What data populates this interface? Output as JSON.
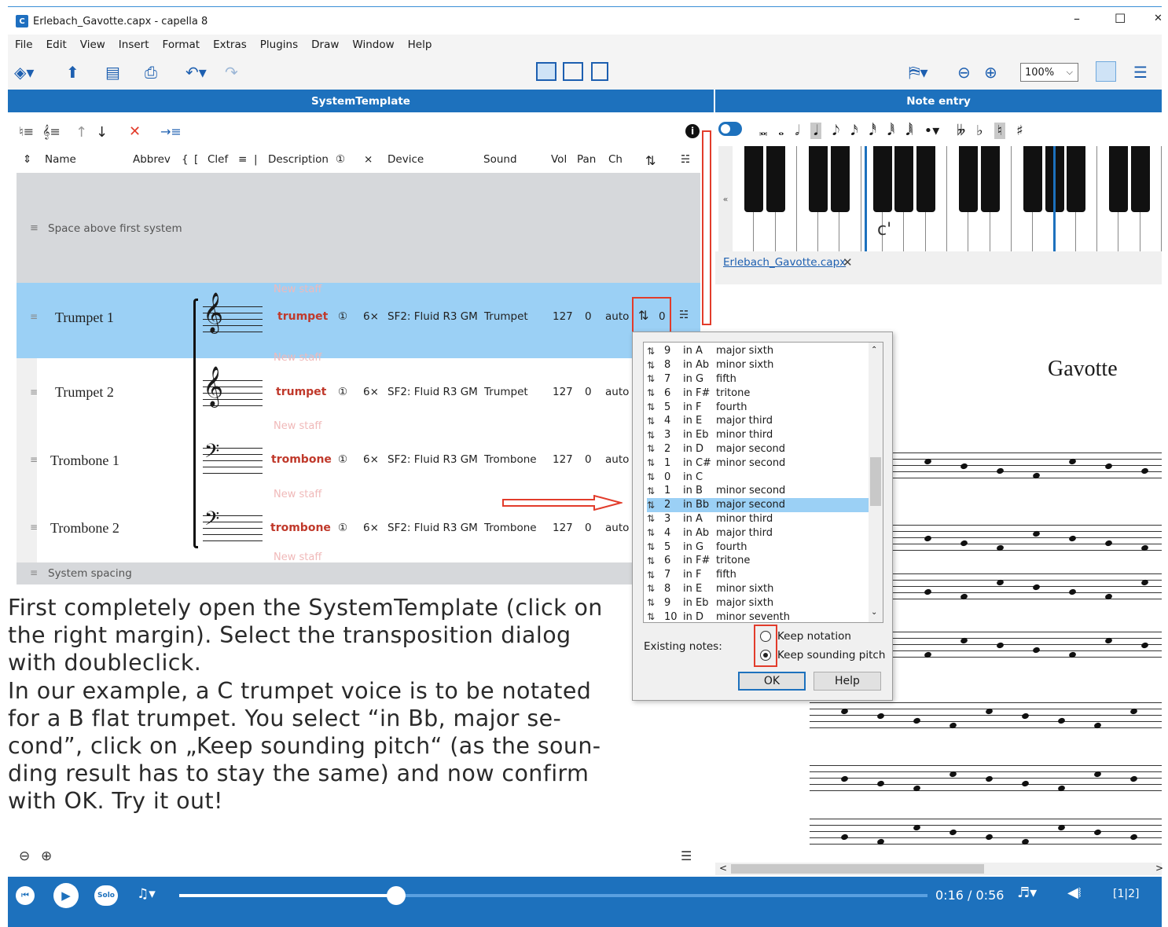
{
  "window": {
    "title": "Erlebach_Gavotte.capx - capella 8",
    "icon": "capella-app-icon",
    "minimize": "–",
    "maximize": "☐",
    "close": "✕"
  },
  "menu": [
    "File",
    "Edit",
    "View",
    "Insert",
    "Format",
    "Extras",
    "Plugins",
    "Draw",
    "Window",
    "Help"
  ],
  "toolbar": {
    "zoom": "100%",
    "zoom_arrow": "⌵"
  },
  "left_pane": {
    "title": "SystemTemplate",
    "columns": [
      "Name",
      "Abbrev",
      "{",
      "[",
      "Clef",
      "≡",
      "|",
      "Description",
      "①",
      "×",
      "Device",
      "Sound",
      "Vol",
      "Pan",
      "Ch"
    ],
    "space_above": "Space above first system",
    "system_spacing": "System spacing",
    "new_staff": "New staff",
    "rows": [
      {
        "name": "Trumpet 1",
        "desc": "trumpet",
        "col1": "①",
        "mult": "6×",
        "device": "SF2: Fluid R3 GM",
        "sound": "Trumpet",
        "vol": "127",
        "pan": "0",
        "ch": "auto",
        "trans": "0"
      },
      {
        "name": "Trumpet 2",
        "desc": "trumpet",
        "col1": "①",
        "mult": "6×",
        "device": "SF2: Fluid R3 GM",
        "sound": "Trumpet",
        "vol": "127",
        "pan": "0",
        "ch": "auto"
      },
      {
        "name": "Trombone 1",
        "desc": "trombone",
        "col1": "①",
        "mult": "6×",
        "device": "SF2: Fluid R3 GM",
        "sound": "Trombone",
        "vol": "127",
        "pan": "0",
        "ch": "auto"
      },
      {
        "name": "Trombone 2",
        "desc": "trombone",
        "col1": "①",
        "mult": "6×",
        "device": "SF2: Fluid R3 GM",
        "sound": "Trombone",
        "vol": "127",
        "pan": "0",
        "ch": "auto"
      }
    ]
  },
  "right_pane": {
    "title": "Note entry",
    "keyboard_label": "c'",
    "doc_tab": "Erlebach_Gavotte.capx",
    "doc_tab_close": "✕",
    "score_title": "Gavotte",
    "collapse": "«",
    "scroll_left": "<",
    "scroll_right": ">"
  },
  "dialog": {
    "list": [
      {
        "n": "9",
        "key": "in A",
        "int": "major sixth",
        "sel": false
      },
      {
        "n": "8",
        "key": "in Ab",
        "int": "minor sixth",
        "sel": false
      },
      {
        "n": "7",
        "key": "in G",
        "int": "fifth",
        "sel": false
      },
      {
        "n": "6",
        "key": "in F#",
        "int": "tritone",
        "sel": false
      },
      {
        "n": "5",
        "key": "in F",
        "int": "fourth",
        "sel": false
      },
      {
        "n": "4",
        "key": "in E",
        "int": "major third",
        "sel": false
      },
      {
        "n": "3",
        "key": "in Eb",
        "int": "minor third",
        "sel": false
      },
      {
        "n": "2",
        "key": "in D",
        "int": "major second",
        "sel": false
      },
      {
        "n": "1",
        "key": "in C#",
        "int": "minor second",
        "sel": false
      },
      {
        "n": "0",
        "key": "in C",
        "int": "",
        "sel": false
      },
      {
        "n": "1",
        "key": "in B",
        "int": "minor second",
        "sel": false
      },
      {
        "n": "2",
        "key": "in Bb",
        "int": "major second",
        "sel": true
      },
      {
        "n": "3",
        "key": "in A",
        "int": "minor third",
        "sel": false
      },
      {
        "n": "4",
        "key": "in Ab",
        "int": "major third",
        "sel": false
      },
      {
        "n": "5",
        "key": "in G",
        "int": "fourth",
        "sel": false
      },
      {
        "n": "6",
        "key": "in F#",
        "int": "tritone",
        "sel": false
      },
      {
        "n": "7",
        "key": "in F",
        "int": "fifth",
        "sel": false
      },
      {
        "n": "8",
        "key": "in E",
        "int": "minor sixth",
        "sel": false
      },
      {
        "n": "9",
        "key": "in Eb",
        "int": "major sixth",
        "sel": false
      },
      {
        "n": "10",
        "key": "in D",
        "int": "minor seventh",
        "sel": false
      }
    ],
    "existing_notes": "Existing notes:",
    "opt1": "Keep notation",
    "opt2": "Keep sounding pitch",
    "ok": "OK",
    "help": "Help"
  },
  "instructions": "First completely open the SystemTemplate (click on\nthe right margin). Select the transposition dialog\nwith doubleclick.\nIn our example, a C trumpet voice is to be notated\nfor a B flat trumpet. You select “in Bb, major se-\ncond”, click on „Keep sounding pitch“ (as the soun-\nding result has to stay the same) and now confirm\nwith OK. Try it out!",
  "player": {
    "time": "0:16 / 0:56",
    "solo": "Solo",
    "progress": 0.29,
    "pages": "[1|2]"
  },
  "colors": {
    "accent": "#1d71bd",
    "selection": "#9bd0f5",
    "highlight": "#e23c2b"
  }
}
